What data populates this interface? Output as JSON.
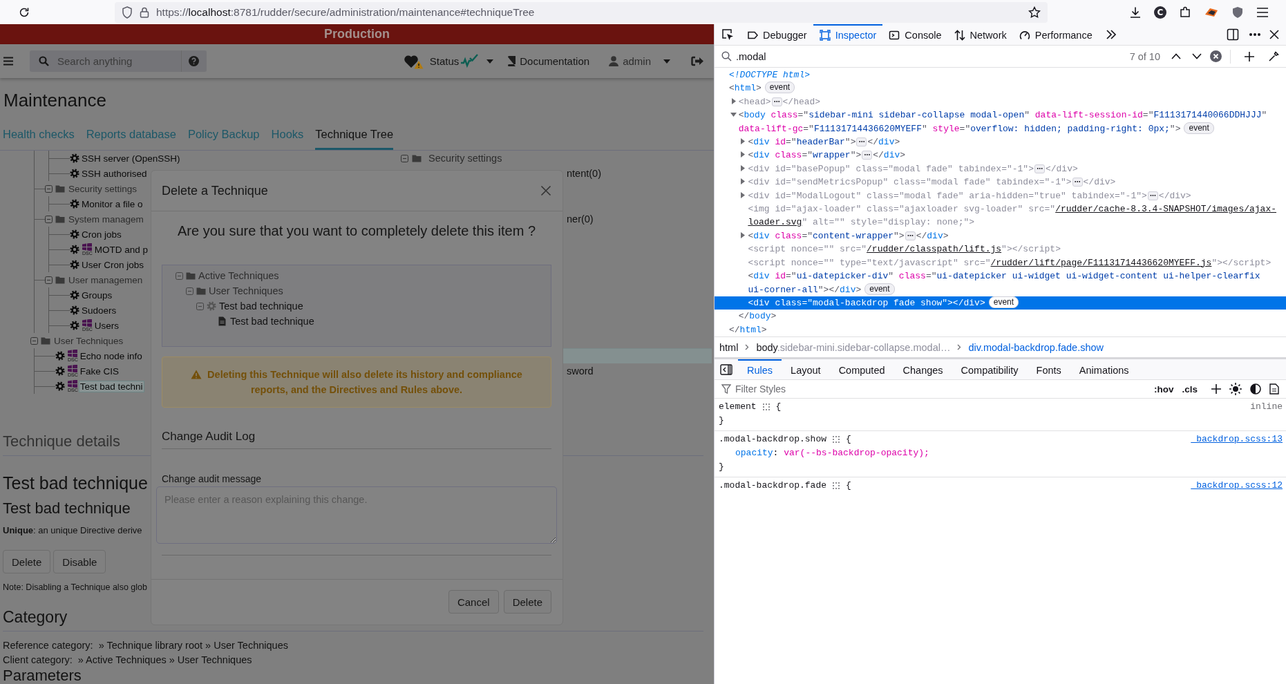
{
  "browser": {
    "url": {
      "scheme": "https://",
      "host": "localhost",
      "rest": ":8781/rudder/secure/administration/maintenance#techniqueTree"
    },
    "extension_letter": "C"
  },
  "page": {
    "banner": "Production",
    "nav": {
      "search_placeholder": "Search anything",
      "status": "Status",
      "documentation": "Documentation",
      "user": "admin"
    },
    "title": "Maintenance",
    "tabs": [
      {
        "label": "Health checks",
        "selected": false
      },
      {
        "label": "Reports database",
        "selected": false
      },
      {
        "label": "Policy Backup",
        "selected": false
      },
      {
        "label": "Hooks",
        "selected": false
      },
      {
        "label": "Technique Tree",
        "selected": true
      }
    ],
    "technique_tree": [
      {
        "kind": "offscreen",
        "children": [
          {
            "kind": "offscreen",
            "children": [
              {
                "kind": "technique",
                "label": "SSH server (OpenSSH)",
                "selected": false
              },
              {
                "kind": "technique",
                "label": "SSH authorised",
                "selected": false
              }
            ]
          },
          {
            "kind": "category",
            "label": "Security settings",
            "expanded": true,
            "children": [
              {
                "kind": "technique",
                "label": "Monitor a file o",
                "selected": false
              }
            ]
          },
          {
            "kind": "category",
            "label": "System managem",
            "expanded": true,
            "children": [
              {
                "kind": "technique",
                "label": "Cron jobs",
                "selected": false
              },
              {
                "kind": "technique",
                "label": "MOTD and p",
                "badge": "DSC",
                "selected": false
              },
              {
                "kind": "technique",
                "label": "User Cron jobs",
                "selected": false
              }
            ]
          },
          {
            "kind": "category",
            "label": "User managemen",
            "expanded": true,
            "children": [
              {
                "kind": "technique",
                "label": "Groups",
                "selected": false
              },
              {
                "kind": "technique",
                "label": "Sudoers",
                "selected": false
              },
              {
                "kind": "technique",
                "label": "Users",
                "badge": "DSC",
                "selected": false
              }
            ]
          }
        ]
      },
      {
        "kind": "category",
        "label": "User Techniques",
        "expanded": true,
        "children": [
          {
            "kind": "technique",
            "label": "Echo node info",
            "badge": "DSC",
            "selected": false
          },
          {
            "kind": "technique",
            "label": "Fake CIS",
            "badge": "DSC",
            "selected": false
          },
          {
            "kind": "technique",
            "label": "Test bad techni",
            "badge": "DSC",
            "selected": true
          }
        ]
      }
    ],
    "directive_rows": [
      {
        "kind": "category",
        "label": "Security settings",
        "expanded": true
      },
      {
        "kind": "item",
        "label": "ntent(0)"
      },
      {
        "kind": "hidden"
      },
      {
        "kind": "hidden"
      },
      {
        "kind": "item",
        "label": "ner(0)"
      },
      {
        "kind": "hidden"
      },
      {
        "kind": "hidden"
      },
      {
        "kind": "hidden"
      },
      {
        "kind": "hidden"
      },
      {
        "kind": "hidden"
      },
      {
        "kind": "hidden"
      },
      {
        "kind": "hidden"
      },
      {
        "kind": "hidden"
      },
      {
        "kind": "band"
      },
      {
        "kind": "item",
        "label": "sword"
      }
    ],
    "details": {
      "heading": "Technique details",
      "name": "Test bad technique",
      "subtitle": "Test bad technique",
      "description": "**Unique**: an unique Directive derive",
      "buttons": [
        "Delete",
        "Disable"
      ],
      "note": "Note: Disabling a Technique also glob"
    },
    "category": {
      "heading": "Category",
      "reference": "Reference category:  » Technique library root » User Techniques",
      "client": "Client category:  » Active Techniques » User Techniques"
    },
    "parameters_heading": "Parameters"
  },
  "modal": {
    "title": "Delete a Technique",
    "question": "Are you sure that you want to completely delete this item ?",
    "tree": [
      {
        "kind": "category",
        "label": "Active Techniques",
        "expanded": true,
        "children": [
          {
            "kind": "category",
            "label": "User Techniques",
            "expanded": true,
            "children": [
              {
                "kind": "technique",
                "label": "Test bad technique",
                "expanded": true,
                "children": [
                  {
                    "kind": "directive",
                    "label": "Test bad technique"
                  }
                ]
              }
            ]
          }
        ]
      }
    ],
    "warning": "Deleting this Technique will also delete its history and compliance reports, and the Directives and Rules above.",
    "audit_heading": "Change Audit Log",
    "audit_label": "Change audit message",
    "audit_placeholder": "Please enter a reason explaining this change.",
    "buttons": [
      "Cancel",
      "Delete"
    ]
  },
  "devtools": {
    "tabs": [
      {
        "label": "Debugger",
        "selected": false
      },
      {
        "label": "Inspector",
        "selected": true
      },
      {
        "label": "Console",
        "selected": false
      },
      {
        "label": "Network",
        "selected": false
      },
      {
        "label": "Performance",
        "selected": false
      }
    ],
    "search": {
      "value": ".modal",
      "count": "7 of 10"
    },
    "markup": [
      {
        "selected": false,
        "dimmed": false,
        "parts": [
          {
            "doc": "<!DOCTYPE html>"
          }
        ]
      },
      {
        "selected": false,
        "dimmed": false,
        "parts": [
          {
            "pu": "<"
          },
          {
            "tag": "html"
          },
          {
            "pu": ">"
          },
          {
            "badge": "event"
          }
        ],
        "close": [
          {
            "pu": "</"
          },
          {
            "tag": "html"
          },
          {
            "pu": ">"
          }
        ],
        "children": [
          {
            "expanded": false,
            "selected": false,
            "dimmed": true,
            "parts": [
              {
                "pu": "<"
              },
              {
                "tag": "head"
              },
              {
                "pu": ">"
              },
              {
                "more": "⋯"
              },
              {
                "pu": "</"
              },
              {
                "tag": "head"
              },
              {
                "pu": ">"
              }
            ]
          },
          {
            "expanded": true,
            "selected": false,
            "dimmed": false,
            "parts": [
              {
                "pu": "<"
              },
              {
                "tag": "body"
              },
              {
                "attr": " class"
              },
              {
                "pu": "=\""
              },
              {
                "val": "sidebar-mini sidebar-collapse modal-open"
              },
              {
                "pu": "\""
              },
              {
                "attr": " data-lift-session-id"
              },
              {
                "pu": "=\""
              },
              {
                "val": "F1113171440066DDHJJJ"
              },
              {
                "pu": "\""
              },
              {
                "attr": " data-lift-gc"
              },
              {
                "pu": "=\""
              },
              {
                "val": "F11131714436620MYEFF"
              },
              {
                "pu": "\""
              },
              {
                "attr": " style"
              },
              {
                "pu": "=\""
              },
              {
                "val": "overflow: hidden; padding-right: 0px;"
              },
              {
                "pu": "\">"
              },
              {
                "badge": "event"
              }
            ],
            "close": [
              {
                "pu": "</"
              },
              {
                "tag": "body"
              },
              {
                "pu": ">"
              }
            ],
            "children": [
              {
                "expanded": false,
                "selected": false,
                "dimmed": false,
                "parts": [
                  {
                    "pu": "<"
                  },
                  {
                    "tag": "div"
                  },
                  {
                    "attr": " id"
                  },
                  {
                    "pu": "=\""
                  },
                  {
                    "val": "headerBar"
                  },
                  {
                    "pu": "\">"
                  },
                  {
                    "more": "⋯"
                  },
                  {
                    "pu": "</"
                  },
                  {
                    "tag": "div"
                  },
                  {
                    "pu": ">"
                  }
                ]
              },
              {
                "expanded": false,
                "selected": false,
                "dimmed": false,
                "parts": [
                  {
                    "pu": "<"
                  },
                  {
                    "tag": "div"
                  },
                  {
                    "attr": " class"
                  },
                  {
                    "pu": "=\""
                  },
                  {
                    "val": "wrapper"
                  },
                  {
                    "pu": "\">"
                  },
                  {
                    "more": "⋯"
                  },
                  {
                    "pu": "</"
                  },
                  {
                    "tag": "div"
                  },
                  {
                    "pu": ">"
                  }
                ]
              },
              {
                "expanded": false,
                "selected": false,
                "dimmed": true,
                "parts": [
                  {
                    "pu": "<"
                  },
                  {
                    "tag": "div"
                  },
                  {
                    "attr": " id"
                  },
                  {
                    "pu": "=\""
                  },
                  {
                    "val": "basePopup"
                  },
                  {
                    "pu": "\""
                  },
                  {
                    "attr": " class"
                  },
                  {
                    "pu": "=\""
                  },
                  {
                    "val": "modal fade"
                  },
                  {
                    "pu": "\""
                  },
                  {
                    "attr": " tabindex"
                  },
                  {
                    "pu": "=\""
                  },
                  {
                    "val": "-1"
                  },
                  {
                    "pu": "\">"
                  },
                  {
                    "more": "⋯"
                  },
                  {
                    "pu": "</"
                  },
                  {
                    "tag": "div"
                  },
                  {
                    "pu": ">"
                  }
                ]
              },
              {
                "expanded": false,
                "selected": false,
                "dimmed": true,
                "parts": [
                  {
                    "pu": "<"
                  },
                  {
                    "tag": "div"
                  },
                  {
                    "attr": " id"
                  },
                  {
                    "pu": "=\""
                  },
                  {
                    "val": "sendMetricsPopup"
                  },
                  {
                    "pu": "\""
                  },
                  {
                    "attr": " class"
                  },
                  {
                    "pu": "=\""
                  },
                  {
                    "val": "modal fade"
                  },
                  {
                    "pu": "\""
                  },
                  {
                    "attr": " tabindex"
                  },
                  {
                    "pu": "=\""
                  },
                  {
                    "val": "-1"
                  },
                  {
                    "pu": "\">"
                  },
                  {
                    "more": "⋯"
                  },
                  {
                    "pu": "</"
                  },
                  {
                    "tag": "div"
                  },
                  {
                    "pu": ">"
                  }
                ]
              },
              {
                "expanded": false,
                "selected": false,
                "dimmed": true,
                "parts": [
                  {
                    "pu": "<"
                  },
                  {
                    "tag": "div"
                  },
                  {
                    "attr": " id"
                  },
                  {
                    "pu": "=\""
                  },
                  {
                    "val": "ModalLogout"
                  },
                  {
                    "pu": "\""
                  },
                  {
                    "attr": " class"
                  },
                  {
                    "pu": "=\""
                  },
                  {
                    "val": "modal fade"
                  },
                  {
                    "pu": "\""
                  },
                  {
                    "attr": " aria-hidden"
                  },
                  {
                    "pu": "=\""
                  },
                  {
                    "val": "true"
                  },
                  {
                    "pu": "\""
                  },
                  {
                    "attr": " tabindex"
                  },
                  {
                    "pu": "=\""
                  },
                  {
                    "val": "-1"
                  },
                  {
                    "pu": "\">"
                  },
                  {
                    "more": "⋯"
                  },
                  {
                    "pu": "</"
                  },
                  {
                    "tag": "div"
                  },
                  {
                    "pu": ">"
                  }
                ]
              },
              {
                "selected": false,
                "dimmed": true,
                "parts": [
                  {
                    "pu": "<"
                  },
                  {
                    "tag": "img"
                  },
                  {
                    "attr": " id"
                  },
                  {
                    "pu": "=\""
                  },
                  {
                    "val": "ajax-loader"
                  },
                  {
                    "pu": "\""
                  },
                  {
                    "attr": " class"
                  },
                  {
                    "pu": "=\""
                  },
                  {
                    "val": "ajaxloader svg-loader"
                  },
                  {
                    "pu": "\""
                  },
                  {
                    "attr": " src"
                  },
                  {
                    "pu": "=\""
                  },
                  {
                    "link": "/rudder/cache-8.3.4-SNAPSHOT/images/ajax-loader.svg"
                  },
                  {
                    "pu": "\""
                  },
                  {
                    "attr": " alt"
                  },
                  {
                    "pu": "=\"\""
                  },
                  {
                    "attr": " style"
                  },
                  {
                    "pu": "=\""
                  },
                  {
                    "val": "display: none;"
                  },
                  {
                    "pu": "\">"
                  }
                ]
              },
              {
                "expanded": false,
                "selected": false,
                "dimmed": false,
                "parts": [
                  {
                    "pu": "<"
                  },
                  {
                    "tag": "div"
                  },
                  {
                    "attr": " class"
                  },
                  {
                    "pu": "=\""
                  },
                  {
                    "val": "content-wrapper"
                  },
                  {
                    "pu": "\">"
                  },
                  {
                    "more": "⋯"
                  },
                  {
                    "pu": "</"
                  },
                  {
                    "tag": "div"
                  },
                  {
                    "pu": ">"
                  }
                ]
              },
              {
                "selected": false,
                "dimmed": true,
                "parts": [
                  {
                    "pu": "<"
                  },
                  {
                    "tag": "script"
                  },
                  {
                    "attr": " nonce"
                  },
                  {
                    "pu": "=\"\""
                  },
                  {
                    "attr": " src"
                  },
                  {
                    "pu": "=\""
                  },
                  {
                    "link": "/rudder/classpath/lift.js"
                  },
                  {
                    "pu": "\"></"
                  },
                  {
                    "tag": "script"
                  },
                  {
                    "pu": ">"
                  }
                ]
              },
              {
                "selected": false,
                "dimmed": true,
                "parts": [
                  {
                    "pu": "<"
                  },
                  {
                    "tag": "script"
                  },
                  {
                    "attr": " nonce"
                  },
                  {
                    "pu": "=\"\""
                  },
                  {
                    "attr": " type"
                  },
                  {
                    "pu": "=\""
                  },
                  {
                    "val": "text/javascript"
                  },
                  {
                    "pu": "\""
                  },
                  {
                    "attr": " src"
                  },
                  {
                    "pu": "=\""
                  },
                  {
                    "link": "/rudder/lift/page/F11131714436620MYEFF.js"
                  },
                  {
                    "pu": "\"></"
                  },
                  {
                    "tag": "script"
                  },
                  {
                    "pu": ">"
                  }
                ]
              },
              {
                "selected": false,
                "dimmed": false,
                "parts": [
                  {
                    "pu": "<"
                  },
                  {
                    "tag": "div"
                  },
                  {
                    "attr": " id"
                  },
                  {
                    "pu": "=\""
                  },
                  {
                    "val": "ui-datepicker-div"
                  },
                  {
                    "pu": "\""
                  },
                  {
                    "attr": " class"
                  },
                  {
                    "pu": "=\""
                  },
                  {
                    "val": "ui-datepicker ui-widget ui-widget-content ui-helper-clearfix ui-corner-all"
                  },
                  {
                    "pu": "\"></"
                  },
                  {
                    "tag": "div"
                  },
                  {
                    "pu": ">"
                  },
                  {
                    "badge": "event"
                  }
                ]
              },
              {
                "selected": true,
                "dimmed": false,
                "parts": [
                  {
                    "pu": "<"
                  },
                  {
                    "tag": "div"
                  },
                  {
                    "attr": " class"
                  },
                  {
                    "pu": "=\""
                  },
                  {
                    "val": "modal-backdrop fade show"
                  },
                  {
                    "pu": "\"></"
                  },
                  {
                    "tag": "div"
                  },
                  {
                    "pu": ">"
                  },
                  {
                    "badge": "event"
                  }
                ]
              }
            ]
          }
        ]
      }
    ],
    "breadcrumb": [
      {
        "tag": "html",
        "selected": false
      },
      {
        "tag": "body",
        "classes": ".sidebar-mini.sidebar-collapse.modal…",
        "selected": false
      },
      {
        "tag": "div.modal-backdrop.fade.show",
        "selected": true
      }
    ],
    "sidebar_tabs": [
      {
        "label": "Rules",
        "selected": true
      },
      {
        "label": "Layout",
        "selected": false
      },
      {
        "label": "Computed",
        "selected": false
      },
      {
        "label": "Changes",
        "selected": false
      },
      {
        "label": "Compatibility",
        "selected": false
      },
      {
        "label": "Fonts",
        "selected": false
      },
      {
        "label": "Animations",
        "selected": false
      }
    ],
    "filter_placeholder": "Filter Styles",
    "toggles": [
      ":hov",
      ".cls"
    ],
    "rules": [
      {
        "selector": "element",
        "open": "{",
        "close": "}",
        "source": "inline",
        "source_is_link": false
      },
      {
        "selector": ".modal-backdrop.show",
        "open": "{",
        "declarations": [
          {
            "property": "opacity",
            "separator": ":",
            "value": "var(--bs-backdrop-opacity);"
          }
        ],
        "close": "}",
        "source": "_backdrop.scss:13",
        "source_is_link": true
      },
      {
        "selector": ".modal-backdrop.fade",
        "open": "{",
        "source": "_backdrop.scss:12",
        "source_is_link": true
      }
    ]
  }
}
